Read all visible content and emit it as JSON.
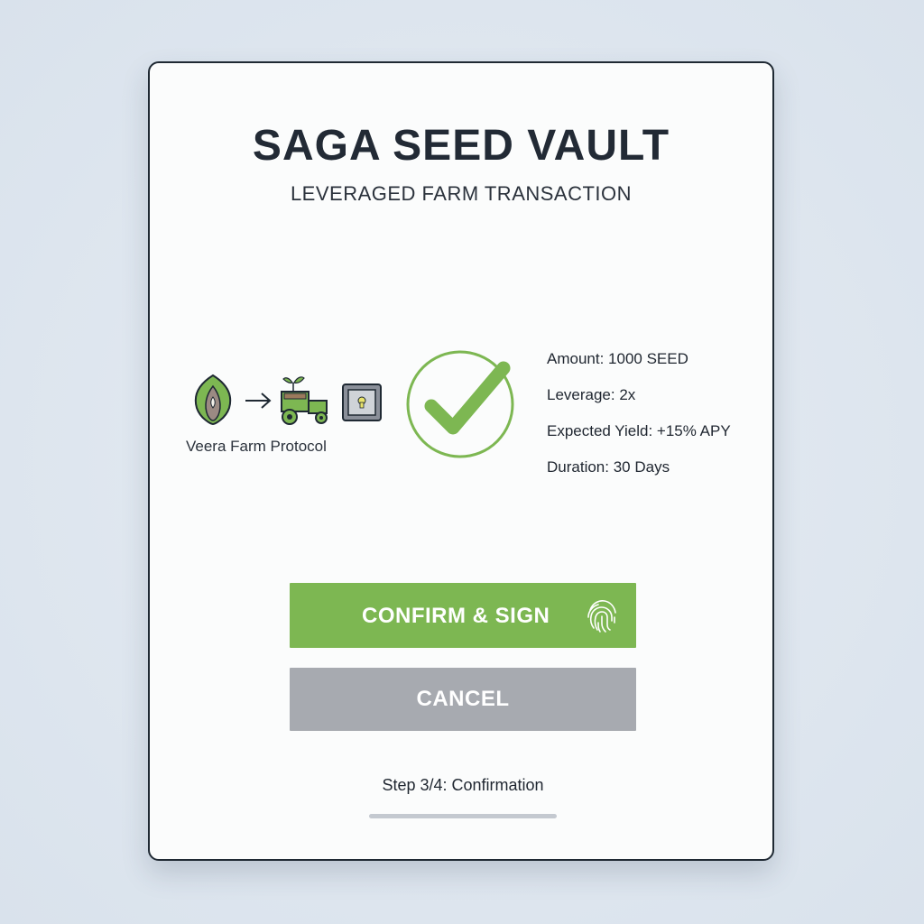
{
  "header": {
    "title": "SAGA SEED VAULT",
    "subtitle": "LEVERAGED FARM TRANSACTION"
  },
  "flow": {
    "icons": [
      "seed-icon",
      "arrow-right-icon",
      "tractor-icon",
      "vault-safe-icon"
    ],
    "protocol_label": "Veera Farm Protocol"
  },
  "status": {
    "icon": "checkmark-circle-icon"
  },
  "details": {
    "amount": "Amount: 1000 SEED",
    "leverage": "Leverage: 2x",
    "expected_yield": "Expected Yield: +15% APY",
    "duration": "Duration: 30 Days"
  },
  "actions": {
    "confirm_label": "CONFIRM & SIGN",
    "confirm_icon": "fingerprint-icon",
    "cancel_label": "CANCEL"
  },
  "progress": {
    "step_text": "Step 3/4: Confirmation"
  },
  "colors": {
    "accent_green": "#7db752",
    "cancel_gray": "#a7aab0",
    "title_dark": "#222a35"
  }
}
